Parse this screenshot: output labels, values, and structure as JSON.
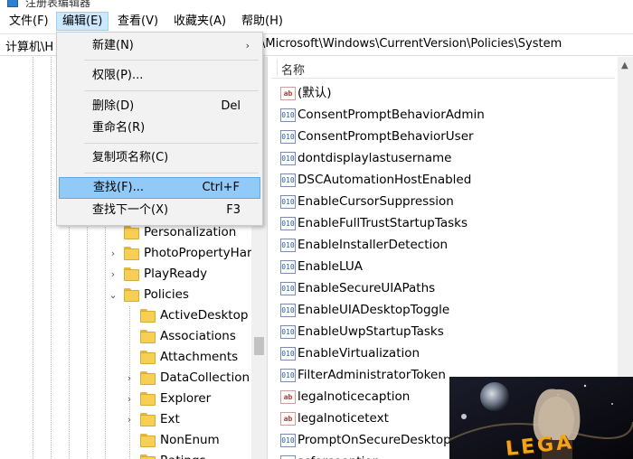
{
  "window": {
    "title": "注册表编辑器"
  },
  "menubar": {
    "items": [
      {
        "label": "文件(F)"
      },
      {
        "label": "编辑(E)"
      },
      {
        "label": "查看(V)"
      },
      {
        "label": "收藏夹(A)"
      },
      {
        "label": "帮助(H)"
      }
    ]
  },
  "address": {
    "left_text": "计算机\\H",
    "right_text": "\\Microsoft\\Windows\\CurrentVersion\\Policies\\System"
  },
  "edit_menu": {
    "items": [
      {
        "label": "新建(N)",
        "shortcut": "",
        "submenu": "›"
      },
      {
        "label": "权限(P)...",
        "shortcut": ""
      },
      {
        "label": "删除(D)",
        "shortcut": "Del"
      },
      {
        "label": "重命名(R)",
        "shortcut": ""
      },
      {
        "label": "复制项名称(C)",
        "shortcut": ""
      },
      {
        "label": "查找(F)...",
        "shortcut": "Ctrl+F"
      },
      {
        "label": "查找下一个(X)",
        "shortcut": "F3"
      }
    ]
  },
  "tree": {
    "items": [
      {
        "label": "Personalization",
        "expander": ""
      },
      {
        "label": "PhotoPropertyHar",
        "expander": "›"
      },
      {
        "label": "PlayReady",
        "expander": "›"
      },
      {
        "label": "Policies",
        "expander": "⌄"
      },
      {
        "label": "ActiveDesktop",
        "expander": ""
      },
      {
        "label": "Associations",
        "expander": ""
      },
      {
        "label": "Attachments",
        "expander": ""
      },
      {
        "label": "DataCollection",
        "expander": "›"
      },
      {
        "label": "Explorer",
        "expander": "›"
      },
      {
        "label": "Ext",
        "expander": "›"
      },
      {
        "label": "NonEnum",
        "expander": ""
      },
      {
        "label": "Ratings",
        "expander": ""
      }
    ]
  },
  "values": {
    "column_name": "名称",
    "items": [
      {
        "name": "(默认)",
        "type": "string",
        "icon": "ab"
      },
      {
        "name": "ConsentPromptBehaviorAdmin",
        "type": "dword",
        "icon": "010"
      },
      {
        "name": "ConsentPromptBehaviorUser",
        "type": "dword",
        "icon": "010"
      },
      {
        "name": "dontdisplaylastusername",
        "type": "dword",
        "icon": "010"
      },
      {
        "name": "DSCAutomationHostEnabled",
        "type": "dword",
        "icon": "010"
      },
      {
        "name": "EnableCursorSuppression",
        "type": "dword",
        "icon": "010"
      },
      {
        "name": "EnableFullTrustStartupTasks",
        "type": "dword",
        "icon": "010"
      },
      {
        "name": "EnableInstallerDetection",
        "type": "dword",
        "icon": "010"
      },
      {
        "name": "EnableLUA",
        "type": "dword",
        "icon": "010"
      },
      {
        "name": "EnableSecureUIAPaths",
        "type": "dword",
        "icon": "010"
      },
      {
        "name": "EnableUIADesktopToggle",
        "type": "dword",
        "icon": "010"
      },
      {
        "name": "EnableUwpStartupTasks",
        "type": "dword",
        "icon": "010"
      },
      {
        "name": "EnableVirtualization",
        "type": "dword",
        "icon": "010"
      },
      {
        "name": "FilterAdministratorToken",
        "type": "dword",
        "icon": "010"
      },
      {
        "name": "legalnoticecaption",
        "type": "string",
        "icon": "ab"
      },
      {
        "name": "legalnoticetext",
        "type": "string",
        "icon": "ab"
      },
      {
        "name": "PromptOnSecureDesktop",
        "type": "dword",
        "icon": "010"
      },
      {
        "name": "scforceoption",
        "type": "dword",
        "icon": "010"
      }
    ]
  },
  "overlay": {
    "caption": "LEGA"
  },
  "colors": {
    "menu_highlight": "#cce8ff",
    "dropdown_highlight": "#91c9f7",
    "folder": "#f7cf52"
  }
}
